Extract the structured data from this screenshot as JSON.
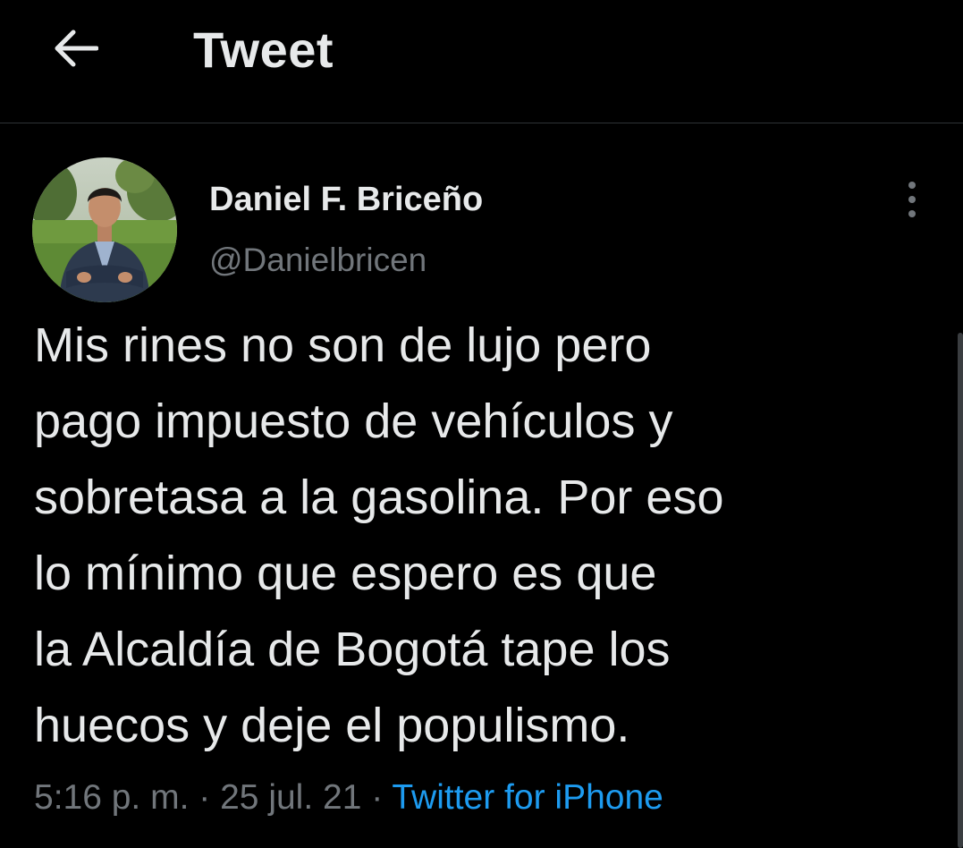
{
  "header": {
    "back_icon": "arrow-left-icon",
    "title": "Tweet"
  },
  "tweet": {
    "author": {
      "display_name": "Daniel F. Briceño",
      "handle": "@Danielbricen",
      "avatar_icon": "profile-photo"
    },
    "more_icon": "vertical-ellipsis-icon",
    "text": "Mis rines no son de lujo pero\npago impuesto de vehículos y\nsobretasa a la gasolina. Por eso\nlo mínimo que espero es que\nla Alcaldía de Bogotá tape los\nhuecos y deje el populismo.",
    "time": "5:16 p. m.",
    "separator": " · ",
    "date": "25 jul. 21",
    "separator2": " · ",
    "source": "Twitter for iPhone"
  },
  "colors": {
    "background": "#000000",
    "primary_text": "#e7e9ea",
    "secondary_text": "#71767b",
    "link": "#1d9bf0",
    "divider": "#2f3336"
  }
}
